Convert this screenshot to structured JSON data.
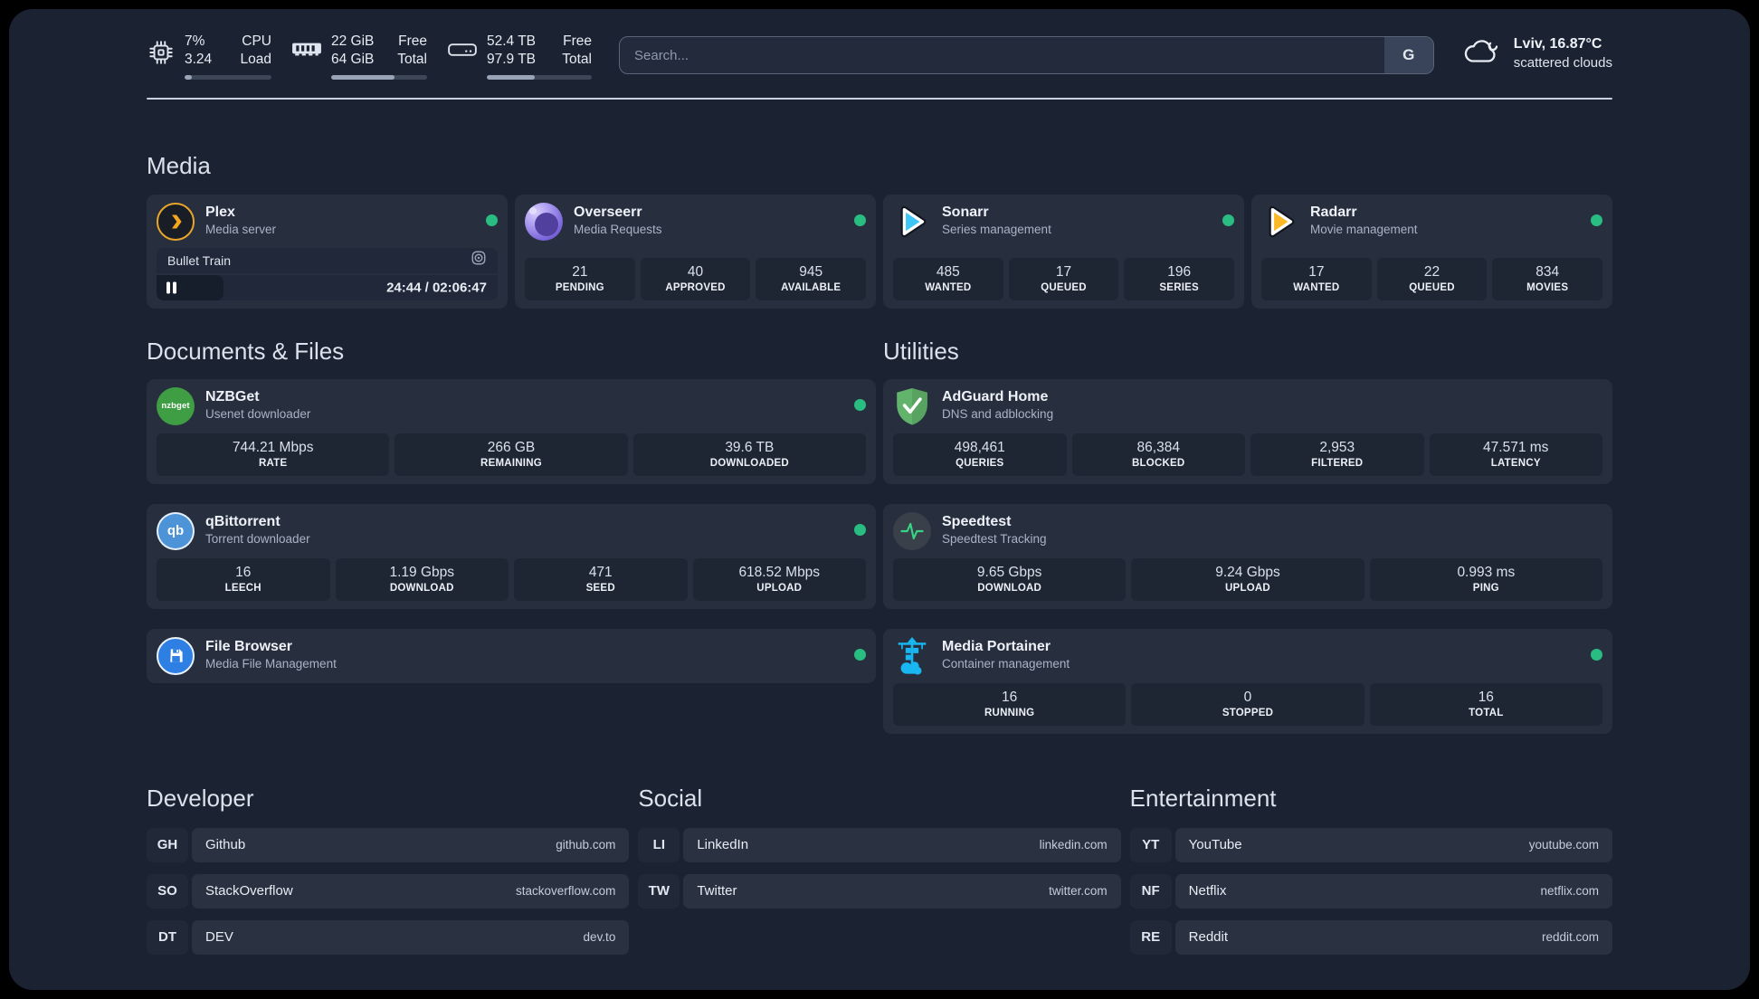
{
  "colors": {
    "background": "#1b2231",
    "card": "#272f3e",
    "status_online": "#29bd82",
    "plex_accent": "#e8a529",
    "sonarr_accent": "#3ec6f4",
    "radarr_accent": "#fcb927",
    "portainer_accent": "#18b7f1"
  },
  "header": {
    "stats": [
      {
        "icon": "cpu-icon",
        "value_top": "7%",
        "value_bottom": "3.24",
        "label_top": "CPU",
        "label_bottom": "Load",
        "progress": 8
      },
      {
        "icon": "memory-icon",
        "value_top": "22 GiB",
        "value_bottom": "64 GiB",
        "label_top": "Free",
        "label_bottom": "Total",
        "progress": 66
      },
      {
        "icon": "disk-icon",
        "value_top": "52.4 TB",
        "value_bottom": "97.9 TB",
        "label_top": "Free",
        "label_bottom": "Total",
        "progress": 46
      }
    ],
    "search": {
      "placeholder": "Search...",
      "provider": "G"
    },
    "weather": {
      "summary": "Lviv, 16.87°C",
      "condition": "scattered clouds"
    }
  },
  "sections": {
    "media": {
      "title": "Media",
      "cards": [
        {
          "title": "Plex",
          "subtitle": "Media server",
          "online": true,
          "now_playing": {
            "title": "Bullet Train",
            "time": "24:44 / 02:06:47",
            "progress_pct": 19.5
          }
        },
        {
          "title": "Overseerr",
          "subtitle": "Media Requests",
          "online": true,
          "stats": [
            {
              "value": "21",
              "label": "PENDING"
            },
            {
              "value": "40",
              "label": "APPROVED"
            },
            {
              "value": "945",
              "label": "AVAILABLE"
            }
          ]
        },
        {
          "title": "Sonarr",
          "subtitle": "Series management",
          "online": true,
          "stats": [
            {
              "value": "485",
              "label": "WANTED"
            },
            {
              "value": "17",
              "label": "QUEUED"
            },
            {
              "value": "196",
              "label": "SERIES"
            }
          ]
        },
        {
          "title": "Radarr",
          "subtitle": "Movie management",
          "online": true,
          "stats": [
            {
              "value": "17",
              "label": "WANTED"
            },
            {
              "value": "22",
              "label": "QUEUED"
            },
            {
              "value": "834",
              "label": "MOVIES"
            }
          ]
        }
      ]
    },
    "documents": {
      "title": "Documents & Files",
      "cards": [
        {
          "title": "NZBGet",
          "subtitle": "Usenet downloader",
          "online": true,
          "stats": [
            {
              "value": "744.21 Mbps",
              "label": "RATE"
            },
            {
              "value": "266 GB",
              "label": "REMAINING"
            },
            {
              "value": "39.6 TB",
              "label": "DOWNLOADED"
            }
          ]
        },
        {
          "title": "qBittorrent",
          "subtitle": "Torrent downloader",
          "online": true,
          "stats": [
            {
              "value": "16",
              "label": "LEECH"
            },
            {
              "value": "1.19 Gbps",
              "label": "DOWNLOAD"
            },
            {
              "value": "471",
              "label": "SEED"
            },
            {
              "value": "618.52 Mbps",
              "label": "UPLOAD"
            }
          ]
        },
        {
          "title": "File Browser",
          "subtitle": "Media File Management",
          "online": true
        }
      ]
    },
    "utilities": {
      "title": "Utilities",
      "cards": [
        {
          "title": "AdGuard Home",
          "subtitle": "DNS and adblocking",
          "stats": [
            {
              "value": "498,461",
              "label": "QUERIES"
            },
            {
              "value": "86,384",
              "label": "BLOCKED"
            },
            {
              "value": "2,953",
              "label": "FILTERED"
            },
            {
              "value": "47.571 ms",
              "label": "LATENCY"
            }
          ]
        },
        {
          "title": "Speedtest",
          "subtitle": "Speedtest Tracking",
          "stats": [
            {
              "value": "9.65 Gbps",
              "label": "DOWNLOAD"
            },
            {
              "value": "9.24 Gbps",
              "label": "UPLOAD"
            },
            {
              "value": "0.993 ms",
              "label": "PING"
            }
          ]
        },
        {
          "title": "Media Portainer",
          "subtitle": "Container management",
          "online": true,
          "stats": [
            {
              "value": "16",
              "label": "RUNNING"
            },
            {
              "value": "0",
              "label": "STOPPED"
            },
            {
              "value": "16",
              "label": "TOTAL"
            }
          ]
        }
      ]
    }
  },
  "bookmarks": [
    {
      "title": "Developer",
      "links": [
        {
          "abbr": "GH",
          "name": "Github",
          "url": "github.com"
        },
        {
          "abbr": "SO",
          "name": "StackOverflow",
          "url": "stackoverflow.com"
        },
        {
          "abbr": "DT",
          "name": "DEV",
          "url": "dev.to"
        }
      ]
    },
    {
      "title": "Social",
      "links": [
        {
          "abbr": "LI",
          "name": "LinkedIn",
          "url": "linkedin.com"
        },
        {
          "abbr": "TW",
          "name": "Twitter",
          "url": "twitter.com"
        }
      ]
    },
    {
      "title": "Entertainment",
      "links": [
        {
          "abbr": "YT",
          "name": "YouTube",
          "url": "youtube.com"
        },
        {
          "abbr": "NF",
          "name": "Netflix",
          "url": "netflix.com"
        },
        {
          "abbr": "RE",
          "name": "Reddit",
          "url": "reddit.com"
        }
      ]
    }
  ]
}
